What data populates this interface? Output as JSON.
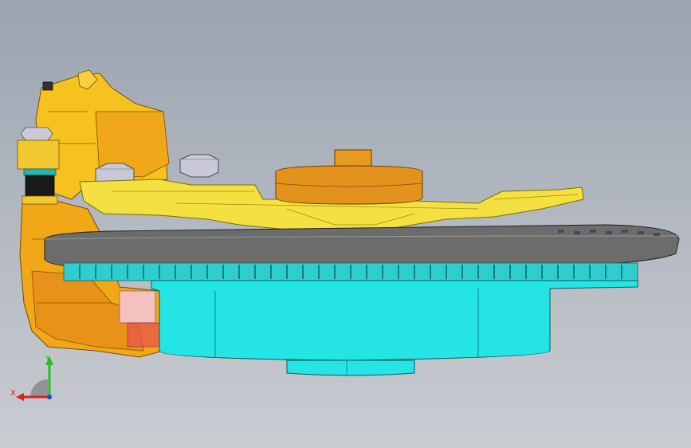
{
  "viewport": {
    "background_top": "#9aa3b0",
    "background_bottom": "#c9ccd1"
  },
  "model": {
    "parts": [
      "caliper",
      "bracket",
      "brake-disc",
      "hub",
      "center-cap",
      "bolt"
    ],
    "colors": {
      "caliper": "#f2b21a",
      "caliper_shade": "#d98a10",
      "bracket": "#f3df3a",
      "disc": "#6f6f6f",
      "hub": "#25e6e6",
      "center_cap": "#e3921c",
      "bolt": "#c8c8d6"
    }
  },
  "triad": {
    "x_label": "X",
    "y_label": "Y",
    "x_color": "#e02020",
    "y_color": "#20c020",
    "z_color": "#2040e0"
  }
}
